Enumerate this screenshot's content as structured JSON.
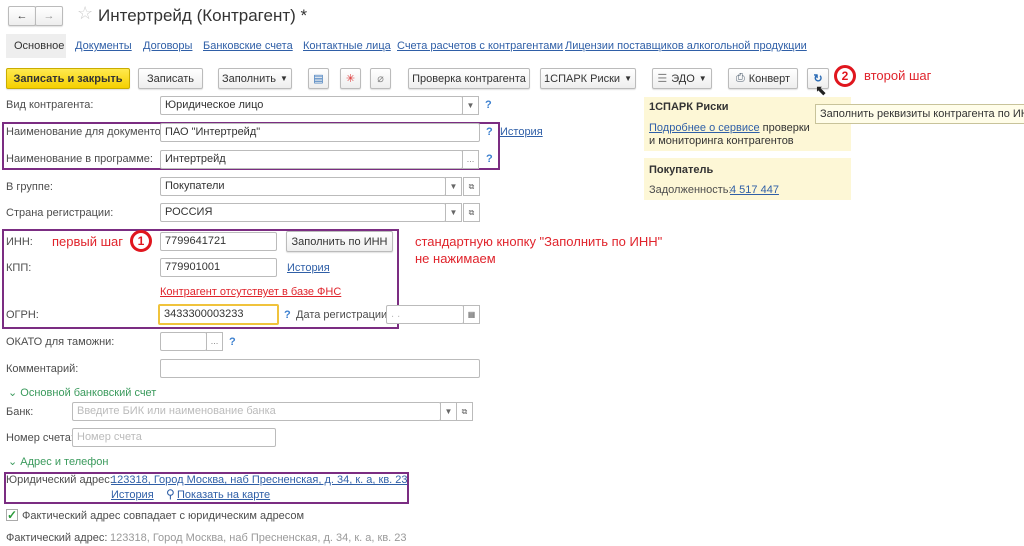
{
  "header": {
    "title": "Интертрейд (Контрагент) *"
  },
  "tabs": [
    "Основное",
    "Документы",
    "Договоры",
    "Банковские счета",
    "Контактные лица",
    "Счета расчетов с контрагентами",
    "Лицензии поставщиков алкогольной продукции"
  ],
  "toolbar": {
    "save_close": "Записать и закрыть",
    "save": "Записать",
    "fill": "Заполнить",
    "check": "Проверка контрагента",
    "spark": "1СПАРК Риски",
    "edo": "ЭДО",
    "envelope": "Конверт"
  },
  "form": {
    "kind_label": "Вид контрагента:",
    "kind_value": "Юридическое лицо",
    "docname_label": "Наименование для документов:",
    "docname_value": "ПАО \"Интертрейд\"",
    "history": "История",
    "progname_label": "Наименование в программе:",
    "progname_value": "Интертрейд",
    "group_label": "В группе:",
    "group_value": "Покупатели",
    "country_label": "Страна регистрации:",
    "country_value": "РОССИЯ",
    "inn_label": "ИНН:",
    "inn_value": "7799641721",
    "fill_by_inn": "Заполнить по ИНН",
    "kpp_label": "КПП:",
    "kpp_value": "779901001",
    "fns_warning": "Контрагент отсутствует в базе ФНС",
    "ogrn_label": "ОГРН:",
    "ogrn_value": "3433300003233",
    "regdate_label": "Дата регистрации:",
    "regdate_value": ". .",
    "okato_label": "ОКАТО для таможни:",
    "comment_label": "Комментарий:",
    "bank_section": "Основной банковский счет",
    "bank_label": "Банк:",
    "bank_placeholder": "Введите БИК или наименование банка",
    "account_label": "Номер счета:",
    "account_placeholder": "Номер счета",
    "address_section": "Адрес и телефон",
    "legal_addr_label": "Юридический адрес:",
    "legal_addr_value": "123318, Город Москва, наб Пресненская, д. 34, к. а, кв. 23",
    "show_map": "Показать на карте",
    "same_addr": "Фактический адрес совпадает с юридическим адресом",
    "fact_addr_label": "Фактический адрес:",
    "fact_addr_value": "123318, Город Москва, наб Пресненская, д. 34, к. а, кв. 23"
  },
  "side": {
    "spark_title": "1СПАРК Риски",
    "spark_link": "Подробнее о сервисе",
    "spark_text1": " проверки",
    "spark_text2": "и мониторинга контрагентов",
    "buyer_title": "Покупатель",
    "debt_label": "Задолженность:",
    "debt_value": "4 517 447"
  },
  "tooltip": "Заполнить реквизиты контрагента по ИНН",
  "annotations": {
    "step1": "первый шаг",
    "step1_num": "1",
    "step2": "второй шаг",
    "step2_num": "2",
    "note1": "стандартную кнопку \"Заполнить по ИНН\"",
    "note2": "не нажимаем"
  }
}
